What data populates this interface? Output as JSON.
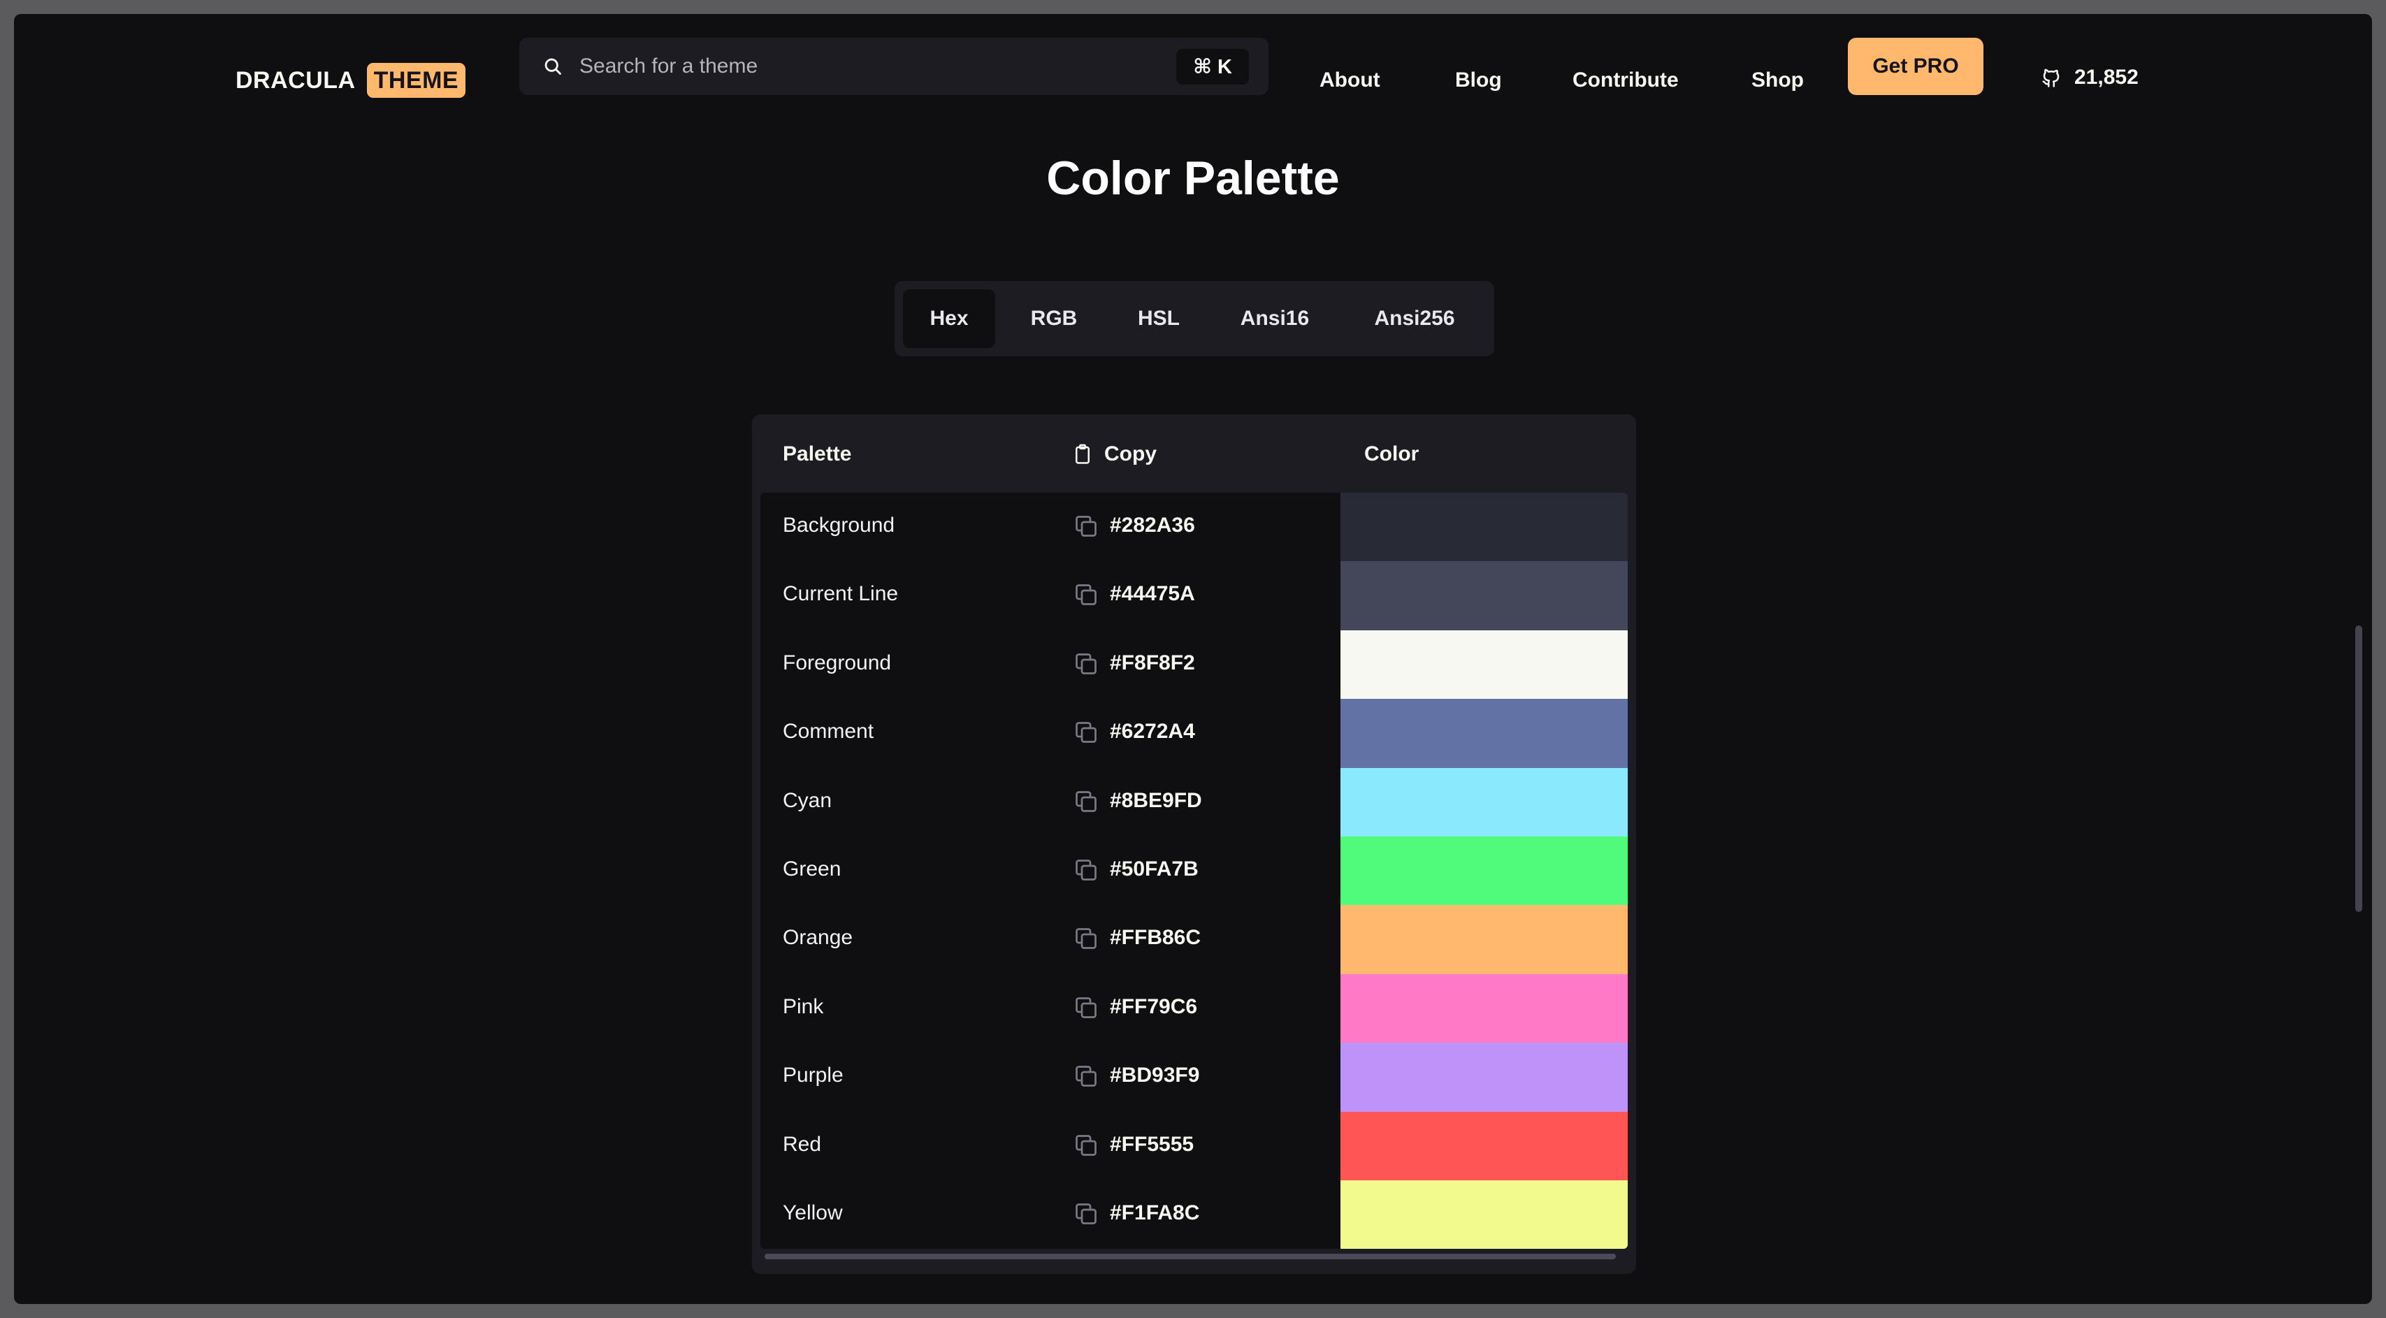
{
  "header": {
    "brand": "DRACULA",
    "badge": "THEME",
    "search_placeholder": "Search for a theme",
    "search_shortcut": "⌘ K",
    "nav": [
      "About",
      "Blog",
      "Contribute",
      "Shop"
    ],
    "pro_label": "Get PRO",
    "github_stars": "21,852"
  },
  "page": {
    "title": "Color Palette"
  },
  "tabs": {
    "items": [
      "Hex",
      "RGB",
      "HSL",
      "Ansi16",
      "Ansi256"
    ],
    "active": "Hex"
  },
  "table": {
    "headers": {
      "palette": "Palette",
      "copy": "Copy",
      "color": "Color"
    },
    "rows": [
      {
        "name": "Background",
        "hex": "#282A36"
      },
      {
        "name": "Current Line",
        "hex": "#44475A"
      },
      {
        "name": "Foreground",
        "hex": "#F8F8F2"
      },
      {
        "name": "Comment",
        "hex": "#6272A4"
      },
      {
        "name": "Cyan",
        "hex": "#8BE9FD"
      },
      {
        "name": "Green",
        "hex": "#50FA7B"
      },
      {
        "name": "Orange",
        "hex": "#FFB86C"
      },
      {
        "name": "Pink",
        "hex": "#FF79C6"
      },
      {
        "name": "Purple",
        "hex": "#BD93F9"
      },
      {
        "name": "Red",
        "hex": "#FF5555"
      },
      {
        "name": "Yellow",
        "hex": "#F1FA8C"
      }
    ]
  },
  "colors": {
    "accent": "#ffb86c",
    "page_bg": "#0f0f12",
    "panel_bg": "#1d1c22"
  },
  "icons": {
    "search": "search-icon",
    "github": "github-icon",
    "clipboard": "clipboard-icon",
    "copy": "copy-icon"
  }
}
